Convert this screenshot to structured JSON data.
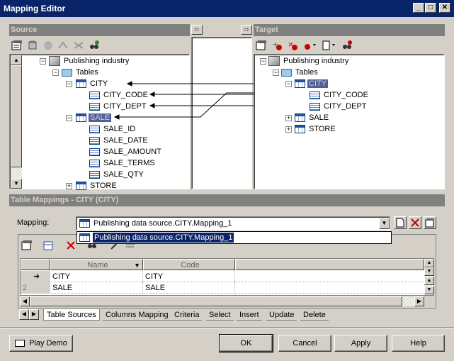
{
  "window": {
    "title": "Mapping Editor",
    "min_glyph": "_",
    "max_glyph": "□",
    "close_glyph": "✕"
  },
  "source": {
    "title": "Source",
    "tree": [
      {
        "label": "Publishing industry"
      },
      {
        "label": "Tables"
      },
      {
        "label": "CITY"
      },
      {
        "label": "CITY_CODE"
      },
      {
        "label": "CITY_DEPT"
      },
      {
        "label": "SALE"
      },
      {
        "label": "SALE_ID"
      },
      {
        "label": "SALE_DATE"
      },
      {
        "label": "SALE_AMOUNT"
      },
      {
        "label": "SALE_TERMS"
      },
      {
        "label": "SALE_QTY"
      },
      {
        "label": "STORE"
      }
    ]
  },
  "target": {
    "title": "Target",
    "tree": [
      {
        "label": "Publishing industry"
      },
      {
        "label": "Tables"
      },
      {
        "label": "CITY"
      },
      {
        "label": "CITY_CODE"
      },
      {
        "label": "CITY_DEPT"
      },
      {
        "label": "SALE"
      },
      {
        "label": "STORE"
      }
    ]
  },
  "table_mappings": {
    "title": "Table Mappings - CITY (CITY)",
    "mapping_label": "Mapping:",
    "mapping_value": "Publishing data source.CITY.Mapping_1",
    "dropdown_option": "Publishing data source.CITY.Mapping_1",
    "grid": {
      "columns": [
        "Name",
        "Code"
      ],
      "rows": [
        {
          "marker": "➜",
          "name": "CITY",
          "code": "CITY"
        },
        {
          "marker": "2",
          "name": "SALE",
          "code": "SALE"
        }
      ]
    },
    "tabs": [
      "Table Sources",
      "Columns Mapping",
      "Criteria",
      "Select",
      "Insert",
      "Update",
      "Delete"
    ]
  },
  "buttons": {
    "play_demo": "Play Demo",
    "ok": "OK",
    "cancel": "Cancel",
    "apply": "Apply",
    "help": "Help"
  },
  "colors": {
    "title_bar": "#0a246a",
    "selection": "#4f5f9a",
    "face": "#d4d0c8"
  }
}
